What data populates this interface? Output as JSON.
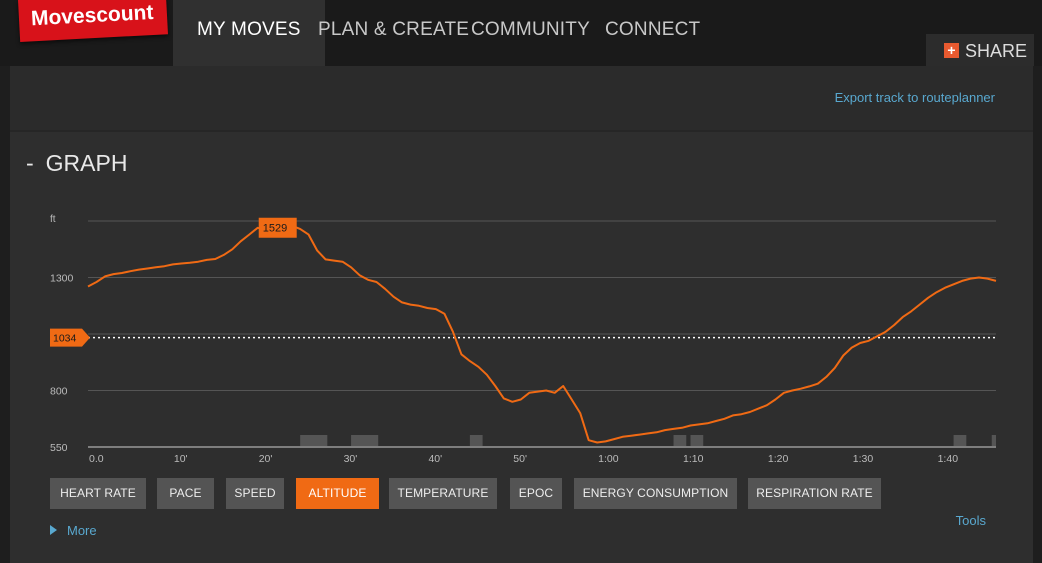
{
  "header": {
    "logo": "Movescount",
    "nav": [
      "MY MOVES",
      "PLAN & CREATE",
      "COMMUNITY",
      "CONNECT"
    ],
    "active_nav": 0,
    "share_label": "SHARE"
  },
  "export_link": "Export track to routeplanner",
  "graph_title": "GRAPH",
  "collapse_glyph": "-",
  "buttons": [
    "HEART RATE",
    "PACE",
    "SPEED",
    "ALTITUDE",
    "TEMPERATURE",
    "EPOC",
    "ENERGY CONSUMPTION",
    "RESPIRATION RATE"
  ],
  "active_button": "ALTITUDE",
  "more_label": "More",
  "tools_label": "Tools",
  "chart_data": {
    "type": "line",
    "ylabel": "ft",
    "x_unit": "minutes",
    "xlim": [
      0,
      107
    ],
    "ylim": [
      550,
      1550
    ],
    "y_ticks": [
      550,
      800,
      1300
    ],
    "x_tick_values": [
      0,
      10,
      20,
      30,
      40,
      50,
      60,
      70,
      80,
      90,
      100
    ],
    "x_tick_labels": [
      "0.0",
      "10'",
      "20'",
      "30'",
      "40'",
      "50'",
      "1:00",
      "1:10",
      "1:20",
      "1:30",
      "1:40"
    ],
    "grid": true,
    "colors": {
      "line": "#f06a14",
      "marker": "#f06a14",
      "grid": "#555555"
    },
    "series": [
      {
        "x": [
          0,
          1,
          2,
          3,
          4,
          5,
          6,
          7,
          8,
          9,
          10,
          11,
          12,
          13,
          14,
          15,
          16,
          17,
          18,
          19,
          20,
          21,
          22,
          23,
          24,
          25,
          26,
          27,
          28,
          29,
          30,
          31,
          32,
          33,
          34,
          35,
          36,
          37,
          38,
          39,
          40,
          41,
          42,
          43,
          44,
          45,
          46,
          47,
          48,
          49,
          50,
          51,
          52,
          53,
          54,
          55,
          56,
          57,
          58,
          59,
          60,
          61,
          62,
          63,
          64,
          65,
          66,
          67,
          68,
          69,
          70,
          71,
          72,
          73,
          74,
          75,
          76,
          77,
          78,
          79,
          80,
          81,
          82,
          83,
          84,
          85,
          86,
          87,
          88,
          89,
          90,
          91,
          92,
          93,
          94,
          95,
          96,
          97,
          98,
          99,
          100,
          101,
          102,
          103,
          104,
          105,
          106,
          107
        ],
        "y": [
          1260,
          1280,
          1305,
          1315,
          1320,
          1328,
          1335,
          1340,
          1345,
          1350,
          1358,
          1362,
          1365,
          1370,
          1378,
          1382,
          1400,
          1425,
          1460,
          1490,
          1520,
          1510,
          1495,
          1520,
          1529,
          1515,
          1490,
          1420,
          1380,
          1375,
          1370,
          1345,
          1310,
          1290,
          1280,
          1250,
          1215,
          1190,
          1180,
          1175,
          1165,
          1160,
          1140,
          1060,
          960,
          930,
          905,
          870,
          820,
          765,
          750,
          760,
          790,
          795,
          800,
          790,
          820,
          760,
          700,
          580,
          570,
          575,
          585,
          595,
          600,
          605,
          610,
          615,
          625,
          630,
          635,
          645,
          650,
          655,
          665,
          675,
          690,
          695,
          705,
          720,
          735,
          760,
          790,
          800,
          808,
          818,
          830,
          860,
          900,
          955,
          990,
          1010,
          1020,
          1040,
          1060,
          1090,
          1125,
          1150,
          1180,
          1210,
          1235,
          1255,
          1270,
          1285,
          1295,
          1300,
          1295,
          1285
        ]
      }
    ],
    "markers": [
      {
        "label": "1529",
        "x": 20,
        "y": 1529
      },
      {
        "label": "1034",
        "y": 1034,
        "type": "reference-line"
      }
    ],
    "gap_ranges": [
      [
        25,
        28.2
      ],
      [
        31,
        34.2
      ],
      [
        45,
        46.5
      ],
      [
        69,
        70.5
      ],
      [
        71,
        72.5
      ],
      [
        102,
        103.5
      ],
      [
        106.5,
        107
      ]
    ]
  }
}
